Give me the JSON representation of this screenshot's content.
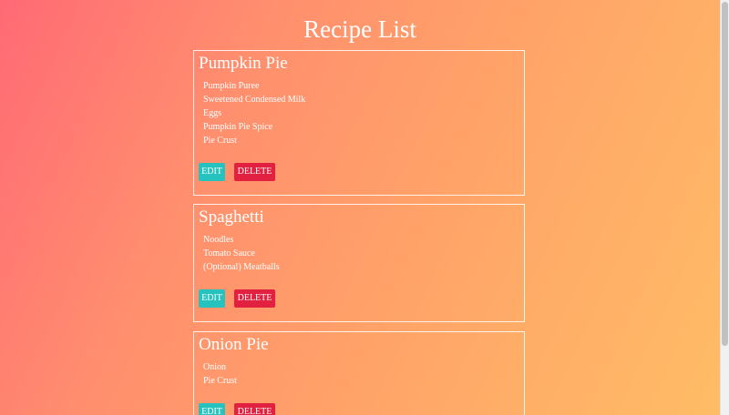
{
  "page": {
    "title": "Recipe List"
  },
  "recipes": [
    {
      "name": "Pumpkin Pie",
      "ingredients": [
        "Pumpkin Puree",
        "Sweetened Condensed Milk",
        "Eggs",
        "Pumpkin Pie Spice",
        "Pie Crust"
      ],
      "edit_label": "EDIT",
      "delete_label": "DELETE"
    },
    {
      "name": "Spaghetti",
      "ingredients": [
        "Noodles",
        "Tomato Sauce",
        "(Optional) Meatballs"
      ],
      "edit_label": "EDIT",
      "delete_label": "DELETE"
    },
    {
      "name": "Onion Pie",
      "ingredients": [
        "Onion",
        "Pie Crust"
      ],
      "edit_label": "EDIT",
      "delete_label": "DELETE"
    }
  ],
  "colors": {
    "edit_button": "#26c2bd",
    "delete_button": "#e2203f",
    "text": "#ffffff"
  }
}
